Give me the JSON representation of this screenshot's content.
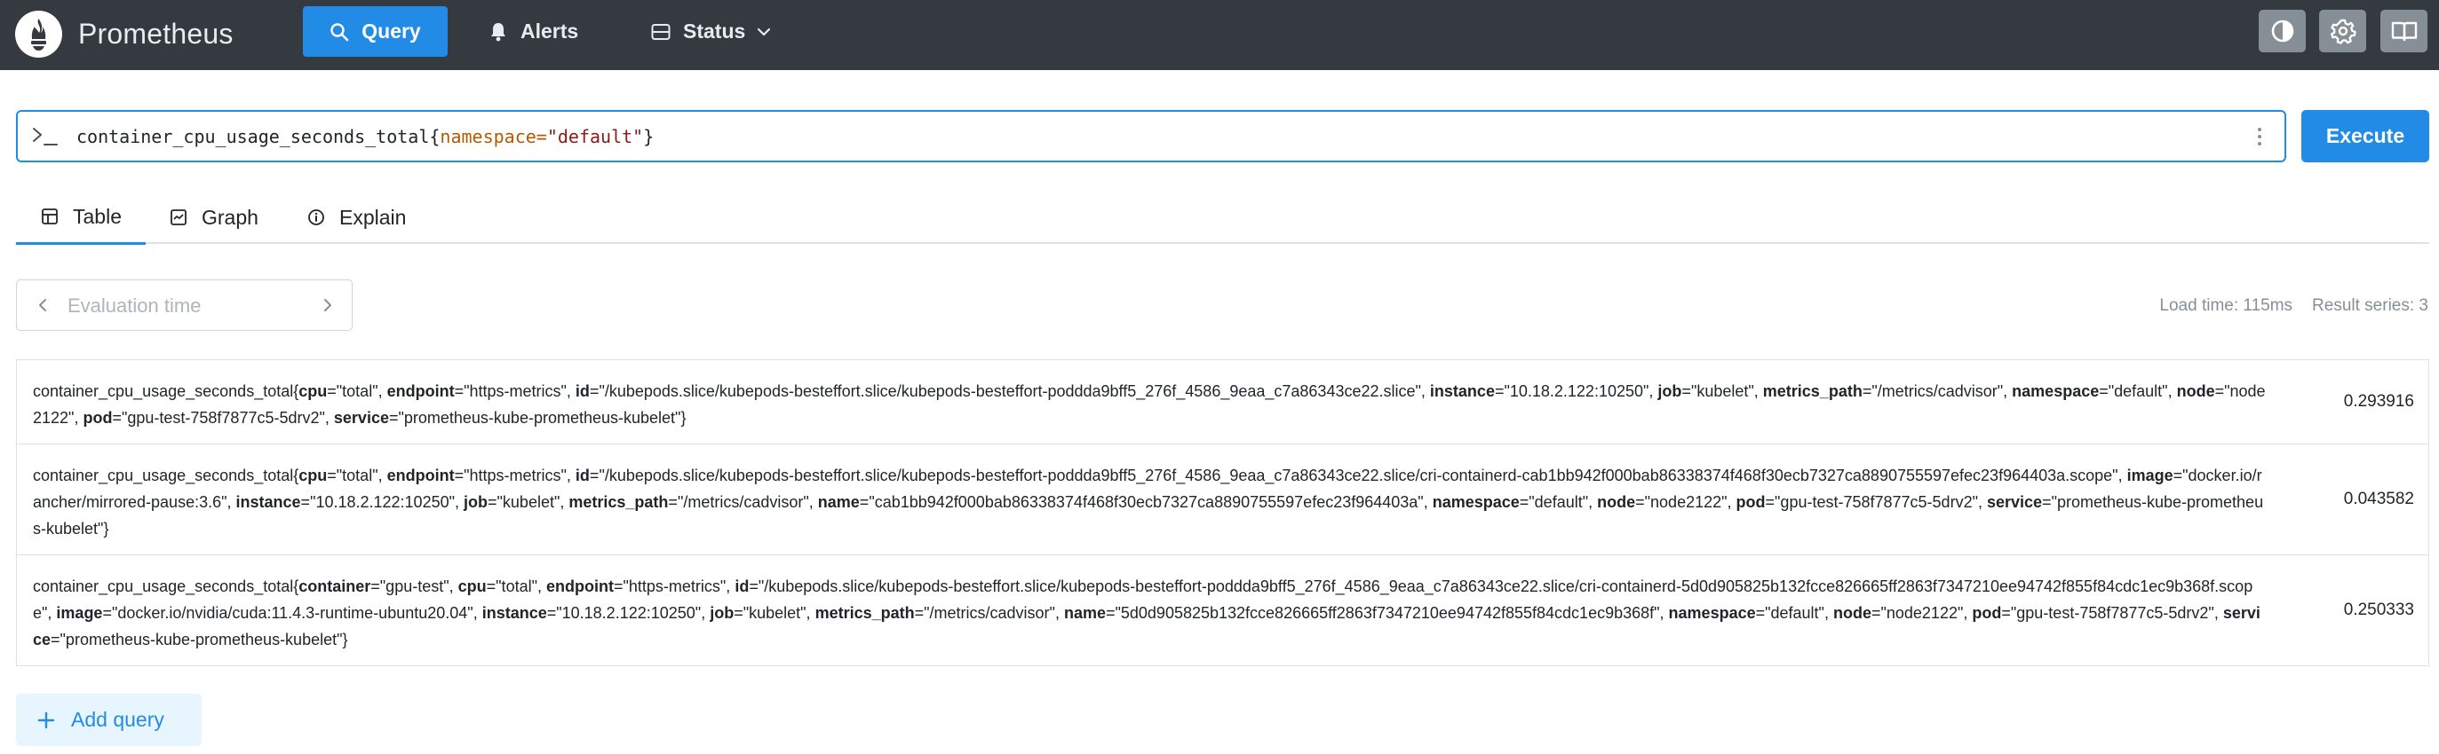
{
  "brand": {
    "name": "Prometheus"
  },
  "nav": {
    "query": "Query",
    "alerts": "Alerts",
    "status": "Status"
  },
  "query": {
    "metric": "container_cpu_usage_seconds_total",
    "open_brace": "{",
    "label": "namespace",
    "op": "=",
    "value": "\"default\"",
    "close_brace": "}"
  },
  "execute_label": "Execute",
  "tabs": {
    "table": "Table",
    "graph": "Graph",
    "explain": "Explain"
  },
  "eval_placeholder": "Evaluation time",
  "stats": {
    "load_time": "Load time: 115ms",
    "result_series": "Result series: 3"
  },
  "results": [
    {
      "metric": "container_cpu_usage_seconds_total",
      "labels": [
        {
          "k": "cpu",
          "v": "\"total\""
        },
        {
          "k": "endpoint",
          "v": "\"https-metrics\""
        },
        {
          "k": "id",
          "v": "\"/kubepods.slice/kubepods-besteffort.slice/kubepods-besteffort-poddda9bff5_276f_4586_9eaa_c7a86343ce22.slice\""
        },
        {
          "k": "instance",
          "v": "\"10.18.2.122:10250\""
        },
        {
          "k": "job",
          "v": "\"kubelet\""
        },
        {
          "k": "metrics_path",
          "v": "\"/metrics/cadvisor\""
        },
        {
          "k": "namespace",
          "v": "\"default\""
        },
        {
          "k": "node",
          "v": "\"node2122\""
        },
        {
          "k": "pod",
          "v": "\"gpu-test-758f7877c5-5drv2\""
        },
        {
          "k": "service",
          "v": "\"prometheus-kube-prometheus-kubelet\""
        }
      ],
      "value": "0.293916"
    },
    {
      "metric": "container_cpu_usage_seconds_total",
      "labels": [
        {
          "k": "cpu",
          "v": "\"total\""
        },
        {
          "k": "endpoint",
          "v": "\"https-metrics\""
        },
        {
          "k": "id",
          "v": "\"/kubepods.slice/kubepods-besteffort.slice/kubepods-besteffort-poddda9bff5_276f_4586_9eaa_c7a86343ce22.slice/cri-containerd-cab1bb942f000bab86338374f468f30ecb7327ca8890755597efec23f964403a.scope\""
        },
        {
          "k": "image",
          "v": "\"docker.io/rancher/mirrored-pause:3.6\""
        },
        {
          "k": "instance",
          "v": "\"10.18.2.122:10250\""
        },
        {
          "k": "job",
          "v": "\"kubelet\""
        },
        {
          "k": "metrics_path",
          "v": "\"/metrics/cadvisor\""
        },
        {
          "k": "name",
          "v": "\"cab1bb942f000bab86338374f468f30ecb7327ca8890755597efec23f964403a\""
        },
        {
          "k": "namespace",
          "v": "\"default\""
        },
        {
          "k": "node",
          "v": "\"node2122\""
        },
        {
          "k": "pod",
          "v": "\"gpu-test-758f7877c5-5drv2\""
        },
        {
          "k": "service",
          "v": "\"prometheus-kube-prometheus-kubelet\""
        }
      ],
      "value": "0.043582"
    },
    {
      "metric": "container_cpu_usage_seconds_total",
      "labels": [
        {
          "k": "container",
          "v": "\"gpu-test\""
        },
        {
          "k": "cpu",
          "v": "\"total\""
        },
        {
          "k": "endpoint",
          "v": "\"https-metrics\""
        },
        {
          "k": "id",
          "v": "\"/kubepods.slice/kubepods-besteffort.slice/kubepods-besteffort-poddda9bff5_276f_4586_9eaa_c7a86343ce22.slice/cri-containerd-5d0d905825b132fcce826665ff2863f7347210ee94742f855f84cdc1ec9b368f.scope\""
        },
        {
          "k": "image",
          "v": "\"docker.io/nvidia/cuda:11.4.3-runtime-ubuntu20.04\""
        },
        {
          "k": "instance",
          "v": "\"10.18.2.122:10250\""
        },
        {
          "k": "job",
          "v": "\"kubelet\""
        },
        {
          "k": "metrics_path",
          "v": "\"/metrics/cadvisor\""
        },
        {
          "k": "name",
          "v": "\"5d0d905825b132fcce826665ff2863f7347210ee94742f855f84cdc1ec9b368f\""
        },
        {
          "k": "namespace",
          "v": "\"default\""
        },
        {
          "k": "node",
          "v": "\"node2122\""
        },
        {
          "k": "pod",
          "v": "\"gpu-test-758f7877c5-5drv2\""
        },
        {
          "k": "service",
          "v": "\"prometheus-kube-prometheus-kubelet\""
        }
      ],
      "value": "0.250333"
    }
  ],
  "add_query_label": "Add query",
  "colors": {
    "navbar": "#343a40",
    "accent": "#228be6",
    "label_key": "#b35a00",
    "string_value": "#8b1a1a"
  },
  "icons": {
    "brand": "prometheus-flame-icon",
    "query": "search-icon",
    "alerts": "bell-icon",
    "status": "server-icon",
    "theme": "contrast-icon",
    "settings": "gear-icon",
    "docs": "book-icon"
  }
}
